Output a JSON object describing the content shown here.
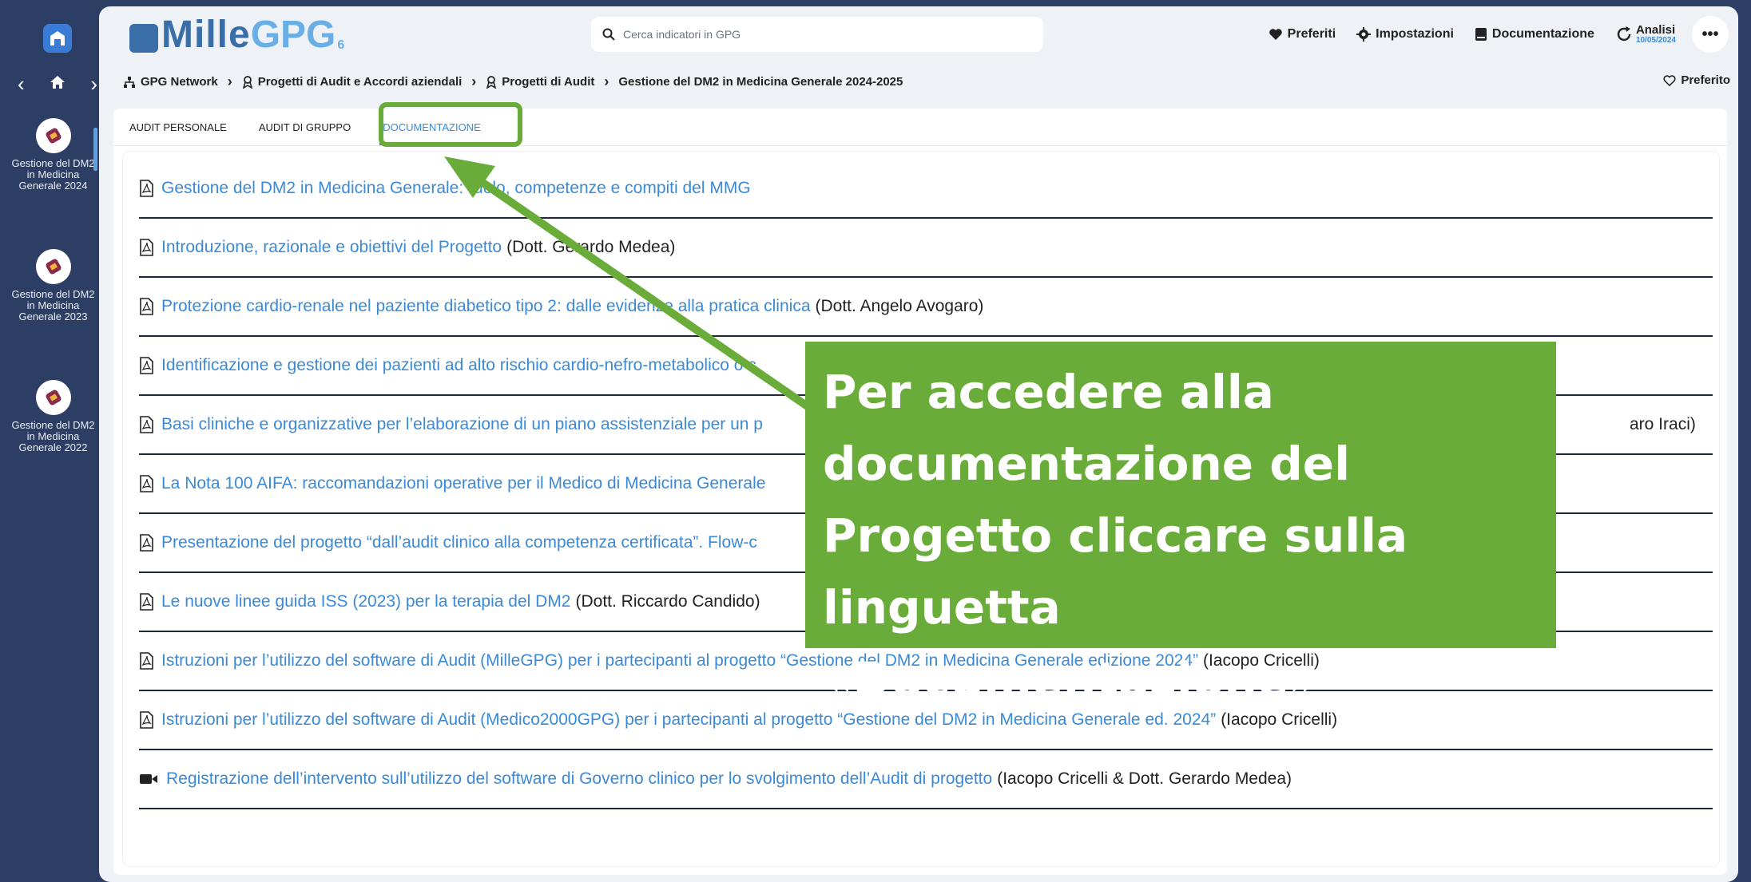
{
  "rail": {
    "items": [
      {
        "label": "Gestione del DM2 in Medicina Generale 2024"
      },
      {
        "label": "Gestione del DM2 in Medicina Generale 2023"
      },
      {
        "label": "Gestione del DM2 in Medicina Generale 2022"
      }
    ]
  },
  "brand": {
    "name_a": "Mille",
    "name_b": "GPG",
    "version": "6"
  },
  "search": {
    "placeholder": "Cerca indicatori in GPG"
  },
  "tools": {
    "preferiti": "Preferiti",
    "impostazioni": "Impostazioni",
    "documentazione": "Documentazione",
    "analisi": "Analisi",
    "analisi_date": "10/05/2024",
    "more": "•••"
  },
  "breadcrumb": {
    "items": [
      "GPG Network",
      "Progetti di Audit e Accordi aziendali",
      "Progetti di Audit",
      "Gestione del DM2 in Medicina Generale 2024-2025"
    ],
    "preferito": "Preferito"
  },
  "tabs": [
    "AUDIT PERSONALE",
    "AUDIT DI GRUPPO",
    "DOCUMENTAZIONE"
  ],
  "documents": [
    {
      "title": "Gestione del DM2 in Medicina Generale: ruolo, competenze e compiti del MMG",
      "author": ""
    },
    {
      "title": "Introduzione, razionale e obiettivi del Progetto",
      "author": "(Dott. Gerardo Medea)"
    },
    {
      "title": "Protezione cardio-renale nel paziente diabetico tipo 2: dalle evidenze alla pratica clinica",
      "author": "(Dott. Angelo Avogaro)"
    },
    {
      "title": "Identificazione e gestione dei pazienti ad alto rischio cardio-nefro-metabolico o c",
      "author": ""
    },
    {
      "title": "Basi cliniche e organizzative per l’elaborazione di un piano assistenziale per un p",
      "author": "aro Iraci)"
    },
    {
      "title": "La Nota 100 AIFA: raccomandazioni operative per il Medico di Medicina Generale",
      "author": ""
    },
    {
      "title": "Presentazione del progetto “dall’audit clinico alla competenza certificata”. Flow-c",
      "author": ""
    },
    {
      "title": "Le nuove linee guida ISS (2023) per la terapia del DM2",
      "author": "(Dott. Riccardo Candido)"
    },
    {
      "title": "Istruzioni per l’utilizzo del software di Audit (MilleGPG) per i partecipanti al progetto “Gestione del DM2 in Medicina Generale edizione 2024”",
      "author": "(Iacopo Cricelli)"
    },
    {
      "title": "Istruzioni per l’utilizzo del software di Audit (Medico2000GPG) per i partecipanti al progetto “Gestione del DM2 in Medicina Generale ed. 2024”",
      "author": "(Iacopo Cricelli)"
    },
    {
      "title": "Registrazione dell’intervento sull’utilizzo del software di Governo clinico per lo svolgimento dell’Audit di progetto",
      "author": "(Iacopo Cricelli & Dott. Gerardo Medea)"
    }
  ],
  "callout": {
    "text": "Per accedere alla documentazione del Progetto cliccare sulla linguetta «Documentazione»"
  },
  "colors": {
    "accent": "#3a8ad8",
    "callout": "#6aac3a",
    "sidebar": "#2c3e64"
  }
}
